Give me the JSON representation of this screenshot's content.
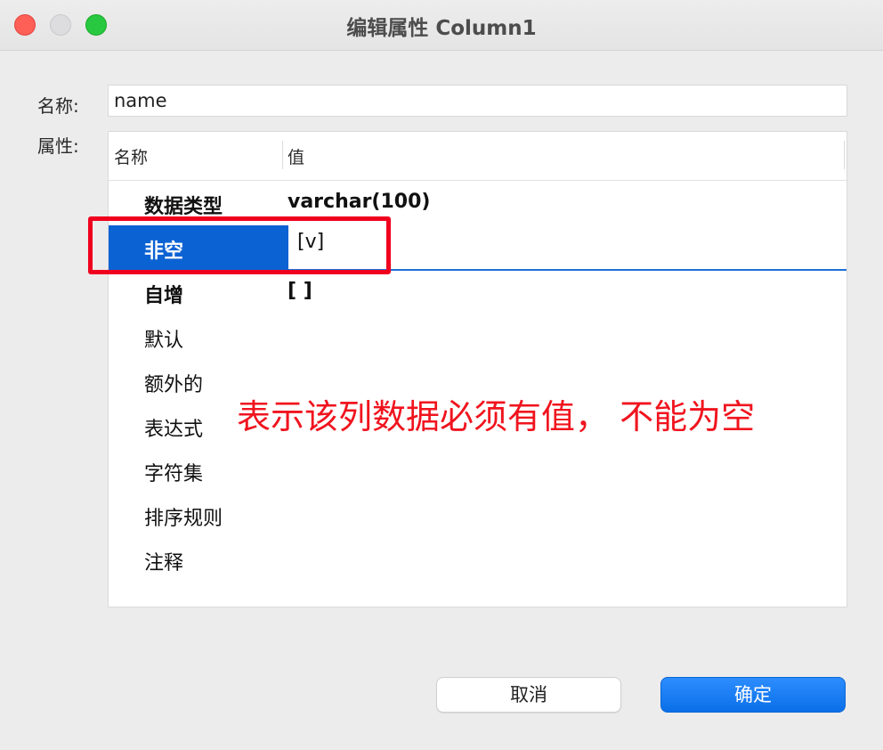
{
  "window": {
    "title": "编辑属性 Column1",
    "buttons": {
      "close": "close-icon",
      "minimize": "minimize-icon",
      "maximize": "maximize-icon"
    }
  },
  "form": {
    "name_label": "名称:",
    "name_value": "name",
    "properties_label": "属性:"
  },
  "table": {
    "headers": [
      "名称",
      "值"
    ],
    "rows": [
      {
        "name": "数据类型",
        "value": "varchar(100)",
        "bold": true
      },
      {
        "name": "非空",
        "value": "[v]",
        "bold": true,
        "selected": true
      },
      {
        "name": "自增",
        "value": "[ ]",
        "bold": true
      },
      {
        "name": "默认",
        "value": ""
      },
      {
        "name": "额外的",
        "value": ""
      },
      {
        "name": "表达式",
        "value": ""
      },
      {
        "name": "字符集",
        "value": ""
      },
      {
        "name": "排序规则",
        "value": ""
      },
      {
        "name": "注释",
        "value": ""
      }
    ]
  },
  "annotation": {
    "text": "表示该列数据必须有值， 不能为空",
    "color": "#f0141e"
  },
  "buttons": {
    "cancel": "取消",
    "ok": "确定"
  },
  "colors": {
    "accent": "#0b62d3",
    "highlight_box": "#f0001e"
  }
}
